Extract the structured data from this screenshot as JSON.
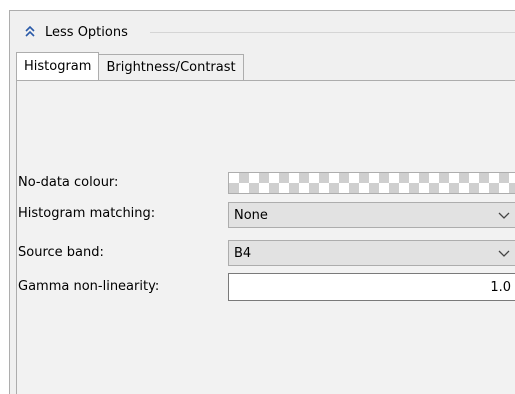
{
  "options_toggle": {
    "label": "Less Options",
    "icon": "chevron-double-up-icon"
  },
  "tabs": [
    {
      "label": "Histogram",
      "active": true
    },
    {
      "label": "Brightness/Contrast",
      "active": false
    }
  ],
  "fields": {
    "nodata": {
      "label": "No-data colour:"
    },
    "histogram_matching": {
      "label": "Histogram matching:",
      "value": "None"
    },
    "source_band": {
      "label": "Source band:",
      "value": "B4"
    },
    "gamma": {
      "label": "Gamma non-linearity:",
      "value": "1.0"
    }
  },
  "colors": {
    "panel_bg": "#f0f0f0",
    "combo_bg": "#e2e2e2",
    "border": "#adadad",
    "checker": "#cfcfcf"
  }
}
